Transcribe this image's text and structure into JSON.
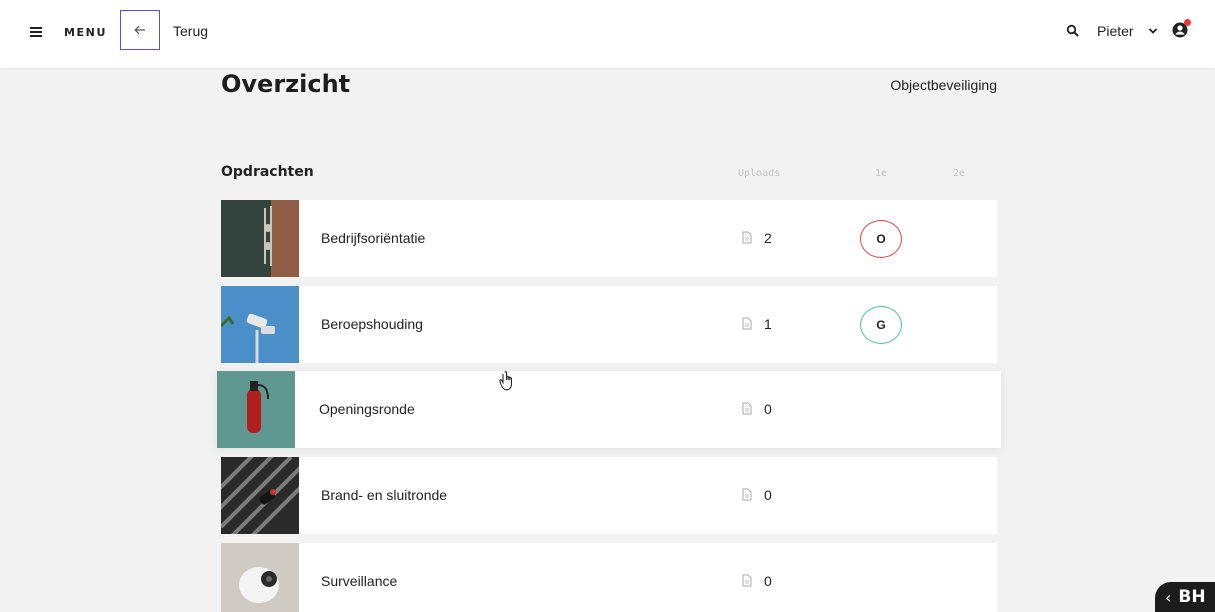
{
  "header": {
    "menu_label": "MENU",
    "back_label": "Terug",
    "user_name": "Pieter"
  },
  "page": {
    "title": "Overzicht",
    "subtitle": "Objectbeveiliging"
  },
  "assignments": {
    "section_title": "Opdrachten",
    "columns": {
      "uploads": "Uploads",
      "first": "1e",
      "second": "2e"
    },
    "rows": [
      {
        "label": "Bedrijfsoriëntatie",
        "uploads": "2",
        "first_grade": "O",
        "grade_color": "#d6454a"
      },
      {
        "label": "Beroepshouding",
        "uploads": "1",
        "first_grade": "G",
        "grade_color": "#4cc38a"
      },
      {
        "label": "Openingsronde",
        "uploads": "0"
      },
      {
        "label": "Brand- en sluitronde",
        "uploads": "0"
      },
      {
        "label": "Surveillance",
        "uploads": "0"
      }
    ]
  },
  "badge": {
    "arrow": "‹",
    "text": "BH"
  },
  "icons": [
    "hamburger-icon",
    "arrow-left-icon",
    "search-icon",
    "chevron-down-icon",
    "user-icon",
    "document-icon",
    "hand-cursor-icon"
  ]
}
